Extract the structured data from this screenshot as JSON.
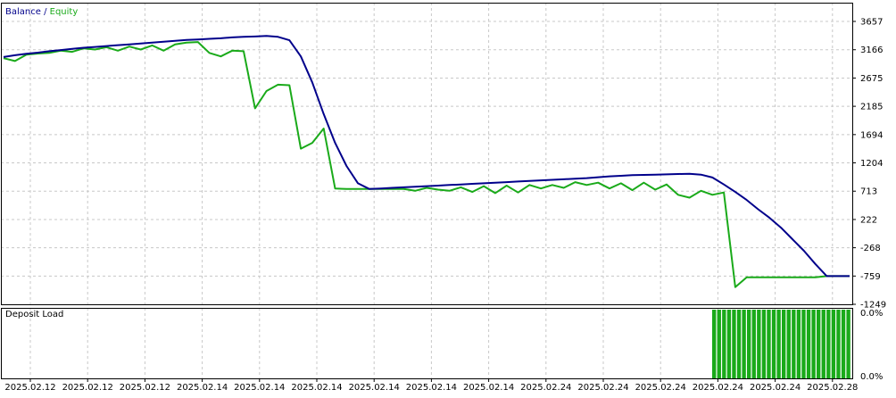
{
  "colors": {
    "balance": "#00008b",
    "equity": "#1aaa1a",
    "deposit_load": "#1aaa1a",
    "grid": "#c8c8c8",
    "frame": "#000000",
    "text": "#000000"
  },
  "chart_data": [
    {
      "type": "line",
      "legend": {
        "balance_label": "Balance",
        "separator": " / ",
        "equity_label": "Equity",
        "placement": "top-left"
      },
      "grid": true,
      "ylim": [
        -1249,
        3657
      ],
      "y_ticks": [
        3657,
        3166,
        2675,
        2185,
        1694,
        1204,
        713,
        222,
        -268,
        -759,
        -1249
      ],
      "x": [
        0,
        2,
        4,
        6,
        8,
        10,
        12,
        14,
        16,
        18,
        20,
        22,
        24,
        26,
        28,
        30,
        32,
        34,
        36,
        38,
        40,
        42,
        44,
        46,
        48,
        50,
        52,
        54,
        56,
        58,
        60,
        62,
        64,
        66,
        68,
        70,
        72,
        74,
        76,
        78,
        80,
        82,
        84,
        86,
        88,
        90,
        92,
        94,
        96,
        98,
        100,
        102,
        104,
        106,
        108,
        110,
        112,
        114,
        116,
        118,
        120,
        122,
        124,
        126,
        128,
        130,
        132,
        134,
        136,
        138,
        140,
        142,
        144,
        146,
        148
      ],
      "series": [
        {
          "name": "Balance",
          "color": "#00008b",
          "values": [
            3040,
            3070,
            3095,
            3115,
            3140,
            3160,
            3180,
            3200,
            3215,
            3230,
            3245,
            3260,
            3275,
            3290,
            3305,
            3320,
            3335,
            3345,
            3355,
            3365,
            3380,
            3390,
            3395,
            3405,
            3390,
            3330,
            3050,
            2600,
            2050,
            1550,
            1150,
            850,
            750,
            760,
            770,
            780,
            790,
            800,
            810,
            820,
            830,
            840,
            850,
            860,
            870,
            880,
            890,
            900,
            910,
            920,
            930,
            940,
            955,
            970,
            980,
            990,
            995,
            1000,
            1005,
            1010,
            1015,
            1000,
            950,
            830,
            700,
            560,
            400,
            250,
            80,
            -120,
            -320,
            -550,
            -760,
            -760,
            -760
          ]
        },
        {
          "name": "Equity",
          "color": "#1aaa1a",
          "values": [
            3020,
            2970,
            3080,
            3100,
            3110,
            3150,
            3130,
            3190,
            3170,
            3210,
            3150,
            3220,
            3170,
            3240,
            3150,
            3260,
            3290,
            3300,
            3110,
            3050,
            3150,
            3140,
            2150,
            2450,
            2560,
            2550,
            1450,
            1550,
            1800,
            760,
            750,
            750,
            750,
            750,
            750,
            750,
            720,
            770,
            740,
            720,
            780,
            700,
            800,
            680,
            810,
            690,
            820,
            760,
            820,
            770,
            870,
            820,
            860,
            760,
            850,
            730,
            860,
            740,
            830,
            650,
            600,
            720,
            650,
            690,
            -950,
            -780,
            -780,
            -780,
            -780,
            -780,
            -780,
            -780,
            -760,
            -760,
            -760
          ]
        }
      ]
    },
    {
      "type": "bar",
      "title": "Deposit Load",
      "y_ticks": [
        "0.0%",
        "0.0%"
      ],
      "bar_count": 28,
      "bar_fill": 1.0,
      "x_ticks": [
        "2025.02.12",
        "2025.02.12",
        "2025.02.12",
        "2025.02.14",
        "2025.02.14",
        "2025.02.14",
        "2025.02.14",
        "2025.02.14",
        "2025.02.14",
        "2025.02.24",
        "2025.02.24",
        "2025.02.24",
        "2025.02.24",
        "2025.02.24",
        "2025.02.28"
      ]
    }
  ]
}
